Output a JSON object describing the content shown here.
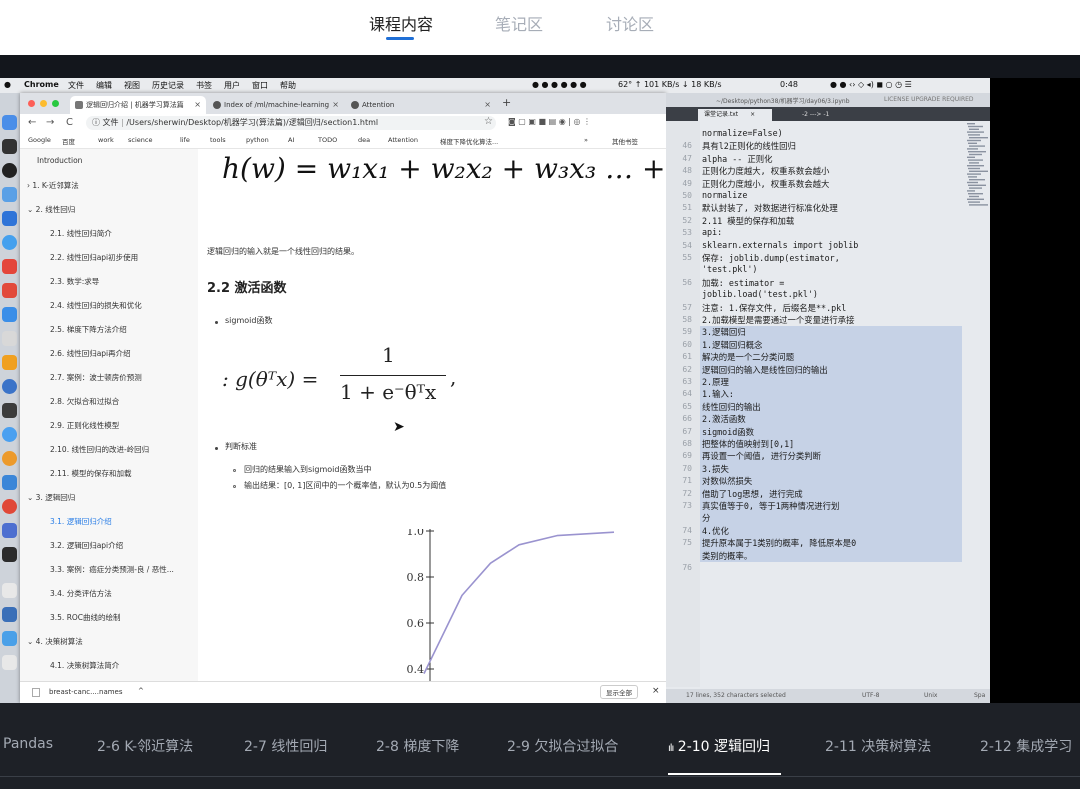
{
  "top_tabs": [
    {
      "label": "课程内容",
      "active": true
    },
    {
      "label": "笔记区",
      "active": false
    },
    {
      "label": "讨论区",
      "active": false
    }
  ],
  "menubar": {
    "items": [
      "Chrome",
      "文件",
      "编辑",
      "视图",
      "历史记录",
      "书签",
      "用户",
      "窗口",
      "帮助"
    ],
    "status": "62°  ↑ 101 KB/s  ↓ 18 KB/s",
    "clock": "0:48"
  },
  "chrome": {
    "tabs": [
      {
        "label": "逻辑回归介绍 | 机器学习算法篇",
        "active": true
      },
      {
        "label": "Index of /ml/machine-learning",
        "active": false
      },
      {
        "label": "Attention",
        "active": false
      }
    ],
    "url_prefix": "文件",
    "url": "/Users/sherwin/Desktop/机器学习(算法篇)/逻辑回归/section1.html",
    "bookmarks": [
      "Google",
      "百度",
      "work",
      "science",
      "life",
      "tools",
      "python",
      "AI",
      "TODO",
      "dea",
      "Attention",
      "梯度下降优化算法...",
      "»",
      "其他书签"
    ],
    "download_file": "breast-canc....names",
    "download_show_all": "显示全部"
  },
  "sidebar": {
    "items": [
      {
        "label": "Introduction",
        "level": 0
      },
      {
        "label": "1. K-近邻算法",
        "level": 0,
        "collapsed": true
      },
      {
        "label": "2. 线性回归",
        "level": 0,
        "expanded": true
      },
      {
        "label": "2.1. 线性回归简介",
        "level": 1
      },
      {
        "label": "2.2. 线性回归api初步使用",
        "level": 1
      },
      {
        "label": "2.3. 数学:求导",
        "level": 1
      },
      {
        "label": "2.4. 线性回归的损失和优化",
        "level": 1
      },
      {
        "label": "2.5. 梯度下降方法介绍",
        "level": 1
      },
      {
        "label": "2.6. 线性回归api再介绍",
        "level": 1
      },
      {
        "label": "2.7. 案例：波士顿房价预测",
        "level": 1
      },
      {
        "label": "2.8. 欠拟合和过拟合",
        "level": 1
      },
      {
        "label": "2.9. 正则化线性模型",
        "level": 1
      },
      {
        "label": "2.10. 线性回归的改进-岭回归",
        "level": 1
      },
      {
        "label": "2.11. 模型的保存和加载",
        "level": 1
      },
      {
        "label": "3. 逻辑回归",
        "level": 0,
        "expanded": true
      },
      {
        "label": "3.1. 逻辑回归介绍",
        "level": 1,
        "active": true
      },
      {
        "label": "3.2. 逻辑回归api介绍",
        "level": 1
      },
      {
        "label": "3.3. 案例：癌症分类预测-良 / 恶性...",
        "level": 1
      },
      {
        "label": "3.4. 分类评估方法",
        "level": 1
      },
      {
        "label": "3.5. ROC曲线的绘制",
        "level": 1
      },
      {
        "label": "4. 决策树算法",
        "level": 0,
        "expanded": true
      },
      {
        "label": "4.1. 决策树算法简介",
        "level": 1
      }
    ]
  },
  "doc": {
    "formula": "h(w) = w₁x₁ + w₂x₂ + w₃x₃ … + b",
    "intro": "逻辑回归的输入就是一个线性回归的结果。",
    "heading": "2.2 激活函数",
    "bullet1": "sigmoid函数",
    "sigmoid_lhs": ": g(θᵀx) =",
    "sigmoid_num": "1",
    "sigmoid_den": "1 + e⁻θᵀx",
    "sigmoid_end": ",",
    "bullet2": "判断标准",
    "sub1": "回归的结果输入到sigmoid函数当中",
    "sub2": "输出结果：[0, 1]区间中的一个概率值，默认为0.5为阈值"
  },
  "plot": {
    "type": "line",
    "ticks": [
      "1.0",
      "0.8",
      "0.6",
      "0.4"
    ],
    "y_values": [
      0.4,
      0.6,
      0.8,
      1.0
    ],
    "curve": {
      "x": [
        0,
        0.1,
        0.2,
        0.35,
        0.5,
        0.7,
        1.0
      ],
      "y": [
        0.38,
        0.55,
        0.72,
        0.86,
        0.94,
        0.98,
        0.995
      ]
    },
    "color": "#9a93cf"
  },
  "editor": {
    "title": "~/Desktop/python38/机器学习/day06/3.ipynb",
    "license": "LICENSE UPGRADE REQUIRED",
    "tabs": [
      {
        "label": "课堂记录.txt",
        "active": true
      },
      {
        "label": "-2 ---> -1",
        "active": false
      }
    ],
    "lines": [
      {
        "n": "",
        "t": "    normalize=False)",
        "hl": false
      },
      {
        "n": "46",
        "t": "        具有l2正则化的线性回归",
        "hl": false
      },
      {
        "n": "47",
        "t": "        alpha -- 正则化",
        "hl": false
      },
      {
        "n": "48",
        "t": "            正则化力度越大, 权重系数会越小",
        "hl": false
      },
      {
        "n": "49",
        "t": "            正则化力度越小, 权重系数会越大",
        "hl": false
      },
      {
        "n": "50",
        "t": "        normalize",
        "hl": false
      },
      {
        "n": "51",
        "t": "            默认封装了, 对数据进行标准化处理",
        "hl": false
      },
      {
        "n": "52",
        "t": "2.11 模型的保存和加载",
        "hl": false
      },
      {
        "n": "53",
        "t": "    api:",
        "hl": false
      },
      {
        "n": "54",
        "t": "    sklearn.externals import joblib",
        "hl": false
      },
      {
        "n": "55",
        "t": "        保存: joblib.dump(estimator,",
        "hl": false
      },
      {
        "n": "",
        "t": "        'test.pkl')",
        "hl": false
      },
      {
        "n": "56",
        "t": "        加载: estimator =",
        "hl": false
      },
      {
        "n": "",
        "t": "        joblib.load('test.pkl')",
        "hl": false
      },
      {
        "n": "57",
        "t": "    注意: 1.保存文件, 后缀名是**.pkl",
        "hl": false
      },
      {
        "n": "58",
        "t": "    2.加载模型是需要通过一个变量进行承接",
        "hl": false
      },
      {
        "n": "59",
        "t": "3.逻辑回归",
        "hl": true
      },
      {
        "n": "60",
        "t": "    1.逻辑回归概念",
        "hl": true
      },
      {
        "n": "61",
        "t": "        解决的是一个二分类问题",
        "hl": true
      },
      {
        "n": "62",
        "t": "        逻辑回归的输入是线性回归的输出",
        "hl": true
      },
      {
        "n": "63",
        "t": "    2.原理",
        "hl": true
      },
      {
        "n": "64",
        "t": "        1.输入:",
        "hl": true
      },
      {
        "n": "65",
        "t": "            线性回归的输出",
        "hl": true
      },
      {
        "n": "66",
        "t": "        2.激活函数",
        "hl": true
      },
      {
        "n": "67",
        "t": "            sigmoid函数",
        "hl": true
      },
      {
        "n": "68",
        "t": "                把整体的值映射到[0,1]",
        "hl": true
      },
      {
        "n": "69",
        "t": "                再设置一个阈值, 进行分类判断",
        "hl": true
      },
      {
        "n": "70",
        "t": "        3.损失",
        "hl": true
      },
      {
        "n": "71",
        "t": "            对数似然损失",
        "hl": true
      },
      {
        "n": "72",
        "t": "                借助了log思想, 进行完成",
        "hl": true
      },
      {
        "n": "73",
        "t": "                真实值等于0, 等于1两种情况进行划",
        "hl": true
      },
      {
        "n": "",
        "t": "                分",
        "hl": true
      },
      {
        "n": "74",
        "t": "        4.优化",
        "hl": true
      },
      {
        "n": "75",
        "t": "            提升原本属于1类别的概率, 降低原本是0",
        "hl": true
      },
      {
        "n": "",
        "t": "            类别的概率。",
        "hl": true
      },
      {
        "n": "76",
        "t": "",
        "hl": false
      }
    ],
    "status_left": "17 lines, 352 characters selected",
    "status_enc": "UTF-8",
    "status_os": "Unix",
    "status_sp": "Spa"
  },
  "chapters": [
    {
      "label": "Pandas",
      "active": false
    },
    {
      "label": "2-6 K-邻近算法",
      "active": false
    },
    {
      "label": "2-7 线性回归",
      "active": false
    },
    {
      "label": "2-8 梯度下降",
      "active": false
    },
    {
      "label": "2-9 欠拟合过拟合",
      "active": false
    },
    {
      "label": "2-10 逻辑回归",
      "active": true
    },
    {
      "label": "2-11 决策树算法",
      "active": false
    },
    {
      "label": "2-12 集成学习",
      "active": false
    }
  ],
  "playing_icon": "bars-icon"
}
